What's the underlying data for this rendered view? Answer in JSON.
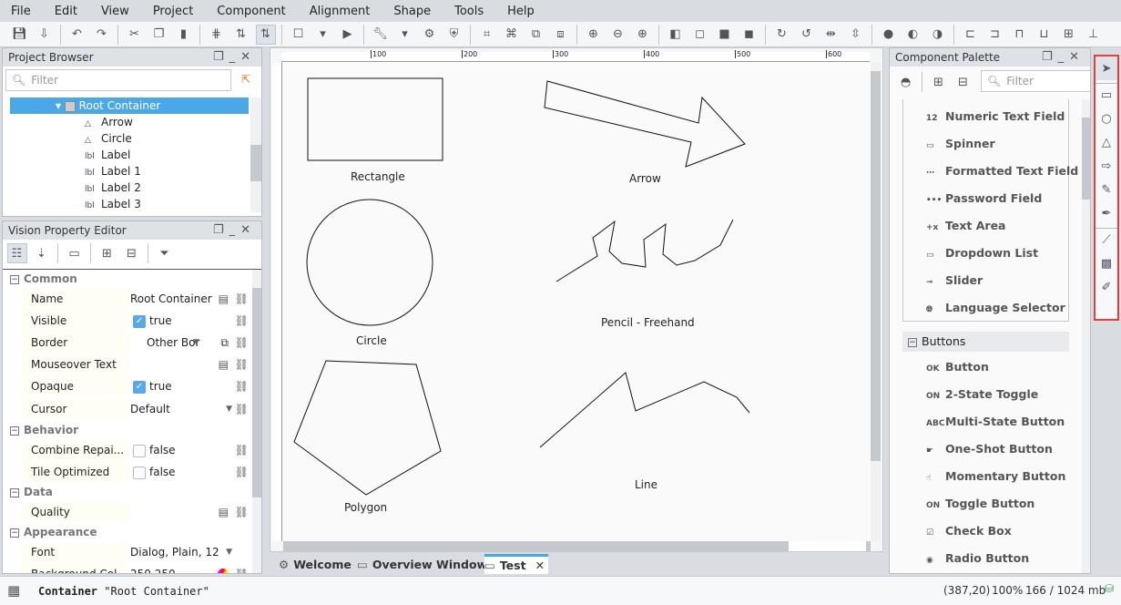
{
  "menu": [
    "File",
    "Edit",
    "View",
    "Project",
    "Component",
    "Alignment",
    "Shape",
    "Tools",
    "Help"
  ],
  "toolbar_icons": [
    "save-icon",
    "save-as-icon",
    "|",
    "undo-icon",
    "redo-icon",
    "|",
    "cut-icon",
    "copy-icon",
    "paste-icon",
    "|",
    "snap-icon",
    "layer-down-icon",
    "layer-up-icon",
    "|",
    "window-icon",
    "dropdown-icon",
    "play-icon",
    "|",
    "wrench-icon",
    "dropdown-icon",
    "settings-icon",
    "shield-icon",
    "|",
    "group-icon",
    "ungroup-icon",
    "group-box-icon",
    "ungroup-box-icon",
    "|",
    "zoom-actual-icon",
    "zoom-out-icon",
    "zoom-in-icon",
    "|",
    "bring-front-icon",
    "send-back-icon",
    "move-forward-icon",
    "move-backward-icon",
    "|",
    "rotate-cw-icon",
    "rotate-ccw-icon",
    "flip-h-icon",
    "flip-v-icon",
    "|",
    "union-icon",
    "subtract-icon",
    "intersect-icon",
    "|",
    "align-left-icon",
    "align-right-icon",
    "align-top-icon",
    "align-bottom-icon",
    "align-center-v-icon",
    "align-center-h-icon"
  ],
  "project_browser": {
    "title": "Project Browser",
    "filter_placeholder": "Filter",
    "root": "Root Container",
    "items": [
      "Arrow",
      "Circle",
      "Label",
      "Label 1",
      "Label 2",
      "Label 3"
    ]
  },
  "property_editor": {
    "title": "Vision Property Editor",
    "sections": {
      "common": "Common",
      "behavior": "Behavior",
      "data": "Data",
      "appearance": "Appearance"
    },
    "rows": {
      "name": [
        "Name",
        "Root Container"
      ],
      "visible": [
        "Visible",
        "true"
      ],
      "border": [
        "Border",
        "Other Bor"
      ],
      "mouseover": [
        "Mouseover Text",
        ""
      ],
      "opaque": [
        "Opaque",
        "true"
      ],
      "cursor": [
        "Cursor",
        "Default"
      ],
      "combine": [
        "Combine Repai...",
        "false"
      ],
      "tile": [
        "Tile Optimized",
        "false"
      ],
      "quality": [
        "Quality",
        ""
      ],
      "font": [
        "Font",
        "Dialog, Plain, 12"
      ],
      "background": [
        "Background Col",
        "250,250"
      ]
    }
  },
  "canvas": {
    "ruler_ticks": [
      "100",
      "200",
      "300",
      "400",
      "500",
      "600"
    ],
    "labels": {
      "rectangle": "Rectangle",
      "arrow": "Arrow",
      "circle": "Circle",
      "pencil": "Pencil - Freehand",
      "polygon": "Polygon",
      "line": "Line"
    }
  },
  "tabs": [
    "Welcome",
    "Overview Window",
    "Test"
  ],
  "palette": {
    "title": "Component Palette",
    "filter_placeholder": "Filter",
    "items": [
      "Numeric Text Field",
      "Spinner",
      "Formatted Text Field",
      "Password Field",
      "Text Area",
      "Dropdown List",
      "Slider",
      "Language Selector"
    ],
    "section": "Buttons",
    "buttons": [
      "Button",
      "2-State Toggle",
      "Multi-State Button",
      "One-Shot Button",
      "Momentary Button",
      "Toggle Button",
      "Check Box",
      "Radio Button"
    ]
  },
  "shape_tools": [
    "pointer-icon",
    "rectangle-icon",
    "ellipse-icon",
    "polygon-icon",
    "arrow-icon",
    "pencil-icon",
    "pen-icon",
    "line-icon",
    "gradient-icon",
    "eyedropper-icon"
  ],
  "status": {
    "type": "Container",
    "name": "\"Root Container\"",
    "coords": "(387,20)",
    "zoom": "100%",
    "memory": "166 / 1024 mb"
  },
  "colors": {
    "selection": "#4aa8e8",
    "highlight": "#f03a3a"
  }
}
